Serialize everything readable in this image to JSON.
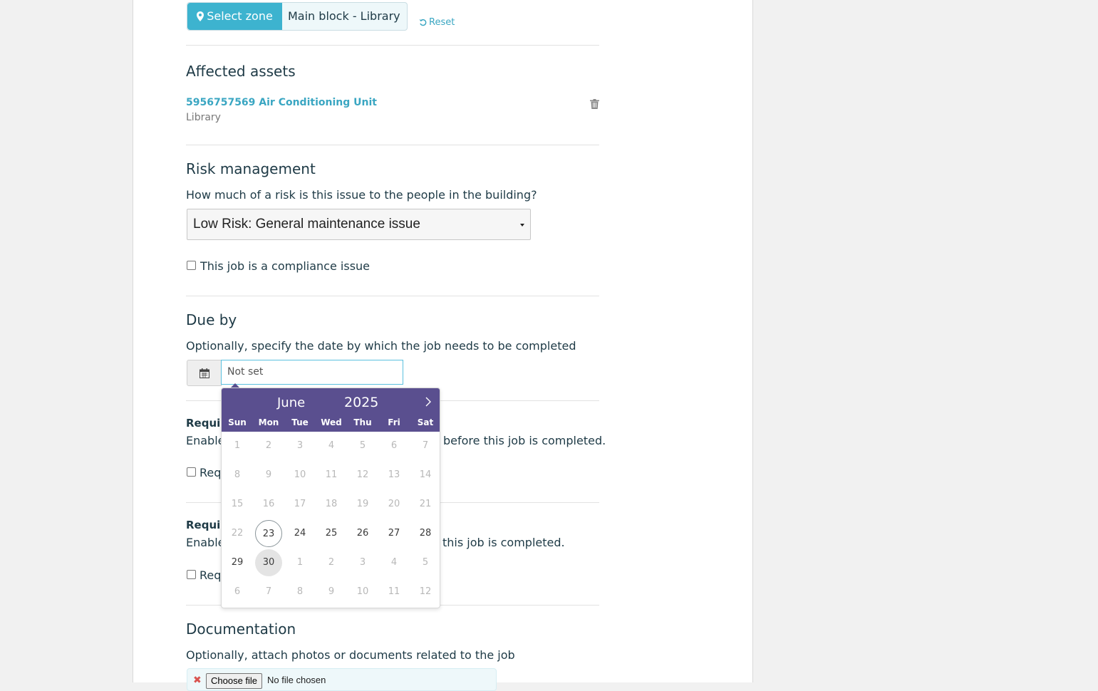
{
  "zone": {
    "select_label": "Select zone",
    "selected_zone": "Main block - Library",
    "reset_label": "Reset"
  },
  "affected_assets": {
    "heading": "Affected assets",
    "asset": {
      "name": "5956757569 Air Conditioning Unit",
      "location": "Library"
    }
  },
  "risk": {
    "heading": "Risk management",
    "question": "How much of a risk is this issue to the people in the building?",
    "selected": "Low Risk: General maintenance issue",
    "compliance_label": "This job is a compliance issue"
  },
  "due_by": {
    "heading": "Due by",
    "description": "Optionally, specify the date by which the job needs to be completed",
    "placeholder": "Not set"
  },
  "requirement_1": {
    "heading_visible": "Requir",
    "desc_left": "Enable",
    "desc_right": "before this job is completed.",
    "checkbox_label_visible": "Req"
  },
  "requirement_2": {
    "heading_visible": "Requir",
    "desc_left": "Enable",
    "desc_right": "this job is completed.",
    "checkbox_label_visible": "Req"
  },
  "documentation": {
    "heading": "Documentation",
    "description": "Optionally, attach photos or documents related to the job",
    "choose_label": "Choose file",
    "no_file": "No file chosen"
  },
  "datepicker": {
    "month": "June",
    "year": "2025",
    "weekdays": [
      "Sun",
      "Mon",
      "Tue",
      "Wed",
      "Thu",
      "Fri",
      "Sat"
    ],
    "weeks": [
      [
        "1",
        "2",
        "3",
        "4",
        "5",
        "6",
        "7"
      ],
      [
        "8",
        "9",
        "10",
        "11",
        "12",
        "13",
        "14"
      ],
      [
        "15",
        "16",
        "17",
        "18",
        "19",
        "20",
        "21"
      ],
      [
        "22",
        "23",
        "24",
        "25",
        "26",
        "27",
        "28"
      ],
      [
        "29",
        "30",
        "1",
        "2",
        "3",
        "4",
        "5"
      ],
      [
        "6",
        "7",
        "8",
        "9",
        "10",
        "11",
        "12"
      ]
    ],
    "enabled_from": "23",
    "today": "23",
    "hovered": "30",
    "header_color": "#5a4f8f"
  },
  "colors": {
    "accent": "#3db3cf",
    "link": "#3aa6c2"
  }
}
